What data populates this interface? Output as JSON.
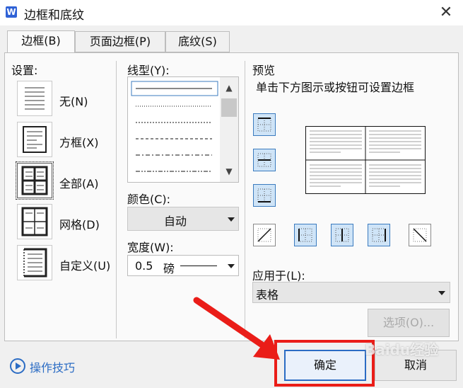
{
  "window": {
    "title": "边框和底纹",
    "app_icon": "W",
    "close_glyph": "✕"
  },
  "tabs": [
    {
      "label": "边框(B)",
      "active": true
    },
    {
      "label": "页面边框(P)",
      "active": false
    },
    {
      "label": "底纹(S)",
      "active": false
    }
  ],
  "settings": {
    "label": "设置:",
    "items": [
      {
        "label": "无(N)",
        "icon": "none-border-icon",
        "selected": false
      },
      {
        "label": "方框(X)",
        "icon": "box-border-icon",
        "selected": false
      },
      {
        "label": "全部(A)",
        "icon": "all-borders-icon",
        "selected": true
      },
      {
        "label": "网格(D)",
        "icon": "grid-border-icon",
        "selected": false
      },
      {
        "label": "自定义(U)",
        "icon": "custom-border-icon",
        "selected": false
      }
    ]
  },
  "line_style": {
    "label": "线型(Y):",
    "styles": [
      "solid",
      "dotted",
      "dashed-small",
      "dashed",
      "dash-dot",
      "dash-dot-dot"
    ]
  },
  "color": {
    "label": "颜色(C):",
    "value": "自动"
  },
  "width": {
    "label": "宽度(W):",
    "value": "0.5",
    "unit": "磅"
  },
  "preview": {
    "label": "预览",
    "hint": "单击下方图示或按钮可设置边框"
  },
  "apply_to": {
    "label": "应用于(L):",
    "value": "表格"
  },
  "buttons": {
    "options": "选项(O)...",
    "ok": "确定",
    "cancel": "取消"
  },
  "tips": {
    "label": "操作技巧"
  },
  "watermark": "Baidu经验",
  "colors": {
    "accent": "#2b6cc4",
    "annotation": "#ea1d18",
    "toggle_on": "#cfe4f7"
  }
}
